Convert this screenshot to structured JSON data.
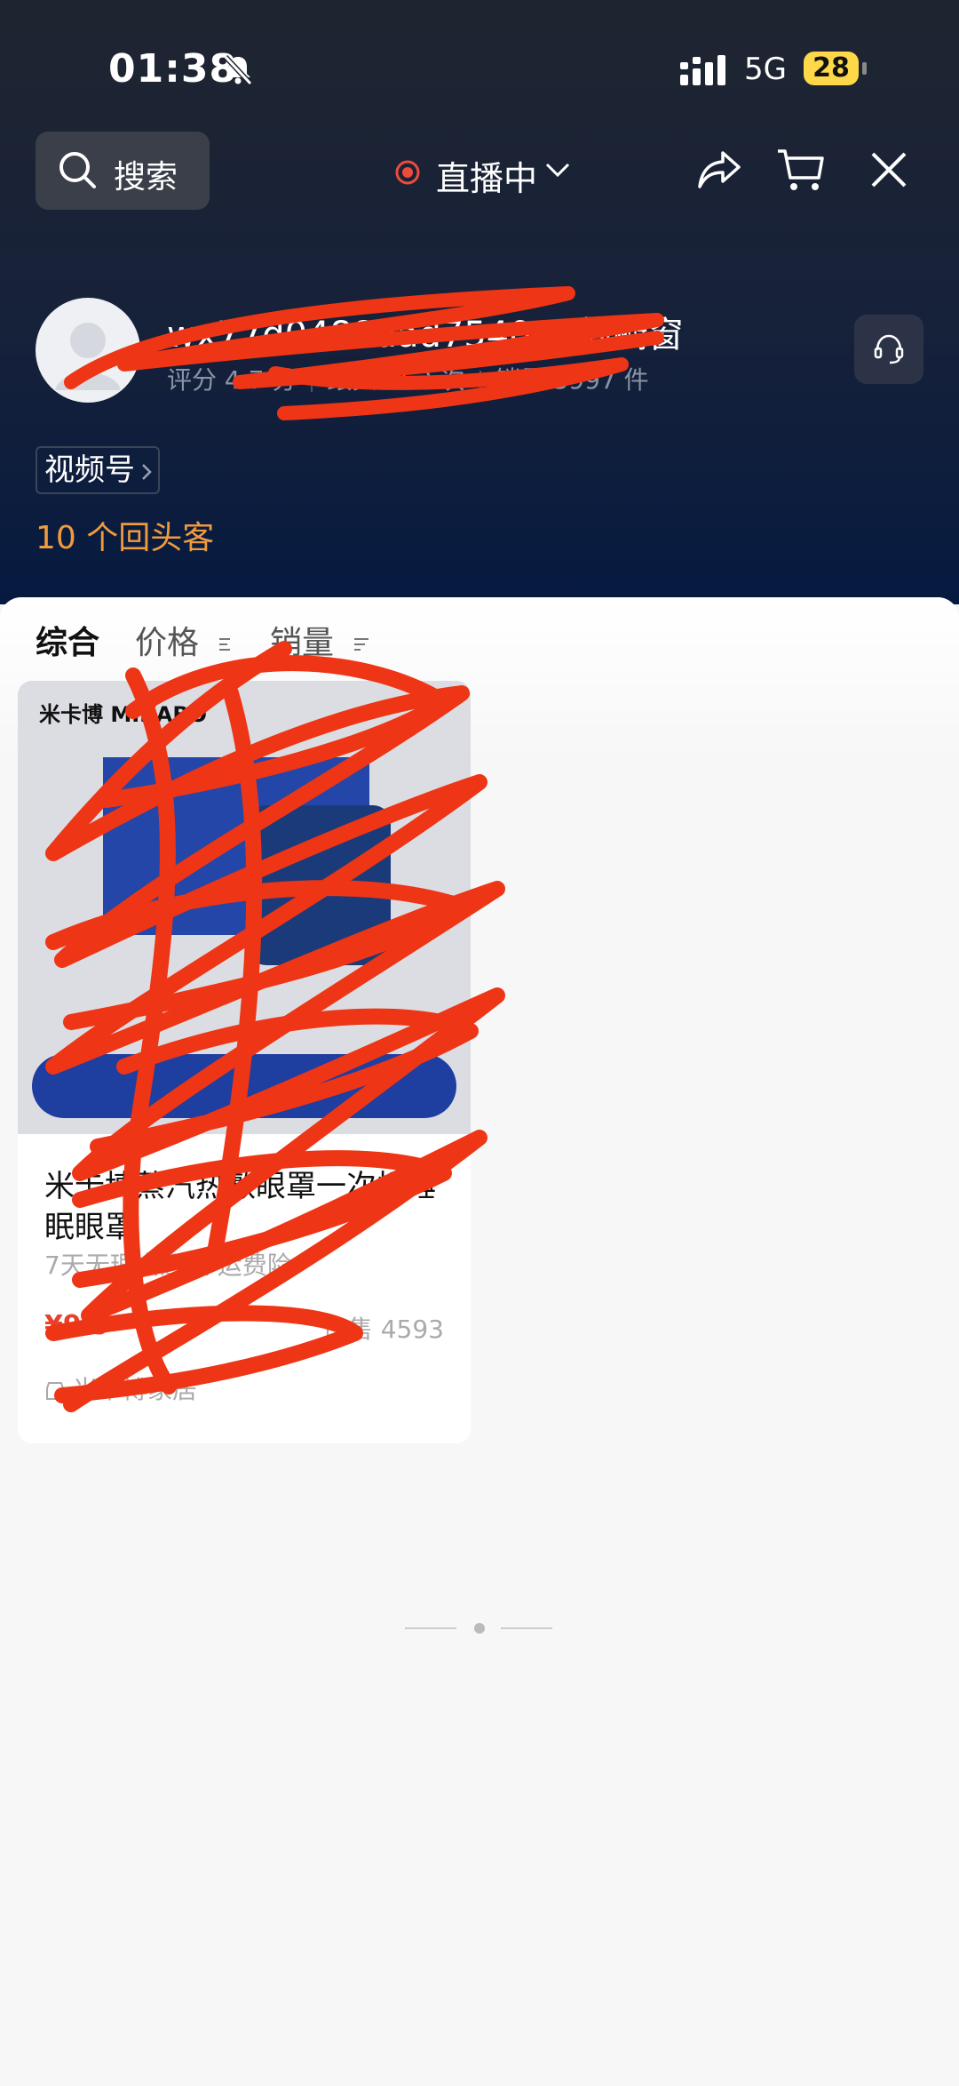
{
  "status_bar": {
    "time": "01:38",
    "network": "5G",
    "battery": "28",
    "icons": [
      "bell-slash-icon",
      "signal-icon"
    ]
  },
  "top_bar": {
    "search_label": "搜索",
    "live_label": "直播中",
    "icons": [
      "search-icon",
      "live-dot-icon",
      "chevron-down-icon",
      "share-icon",
      "cart-icon",
      "close-icon"
    ]
  },
  "store": {
    "name": "wx77d0488aad754069的橱窗",
    "rating": "评分 4.7 分",
    "repeat_sales": "跟头 363 次",
    "sales": "销量 3997 件",
    "video_tag": "视频号",
    "repeat_customers": "10 个回头客",
    "icons": [
      "avatar-icon",
      "customer-service-icon",
      "chevron-right-icon"
    ]
  },
  "tabs": [
    {
      "label": "综合",
      "active": true
    },
    {
      "label": "价格",
      "active": false
    },
    {
      "label": "销量",
      "active": false
    }
  ],
  "products": [
    {
      "brand": "米卡博 MIKABO",
      "title": "米卡博蒸汽热敷眼罩一次性睡眠眼罩",
      "service": "7天无理由退换 运费险",
      "price": "¥9.9",
      "sold": "已售 4593",
      "shop": "米卡博家居"
    }
  ],
  "colors": {
    "header_top": "#1f2530",
    "header_bottom": "#061a40",
    "accent_orange": "#f09a3e",
    "price_red": "#e8402a",
    "live_red": "#ee4b3b",
    "scribble_red": "#ee3515"
  }
}
